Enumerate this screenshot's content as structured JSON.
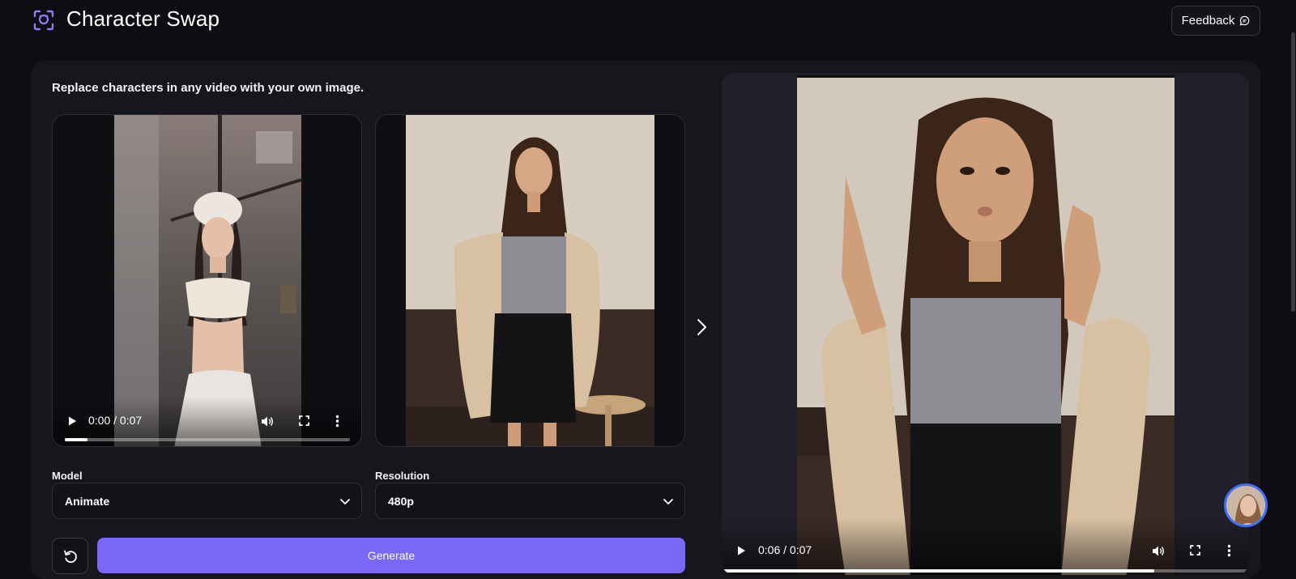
{
  "header": {
    "title": "Character Swap",
    "feedback_label": "Feedback",
    "icons": {
      "logo": "face-scan-icon",
      "feedback": "chat-bubble-icon"
    }
  },
  "main": {
    "subtitle": "Replace characters in any video with your own image.",
    "source_video": {
      "time": "0:00 / 0:07",
      "progress_fraction": 0.08,
      "controls": [
        "play-icon",
        "volume-icon",
        "fullscreen-icon",
        "more-vertical-icon"
      ]
    },
    "reference_image": {},
    "model": {
      "label": "Model",
      "value": "Animate"
    },
    "resolution": {
      "label": "Resolution",
      "value": "480p"
    },
    "generate_label": "Generate",
    "icons": {
      "next": "chevron-right-icon",
      "reset": "reset-icon",
      "select": "chevron-down-icon"
    }
  },
  "result": {
    "time": "0:06 / 0:07",
    "progress_fraction": 0.82,
    "controls": [
      "play-icon",
      "volume-icon",
      "fullscreen-icon",
      "more-vertical-icon"
    ]
  },
  "colors": {
    "background": "#0e0d12",
    "panel": "#17161d",
    "accent": "#7a67f5",
    "logo": "#8b7cf7",
    "avatar_ring": "#3f6df5"
  }
}
